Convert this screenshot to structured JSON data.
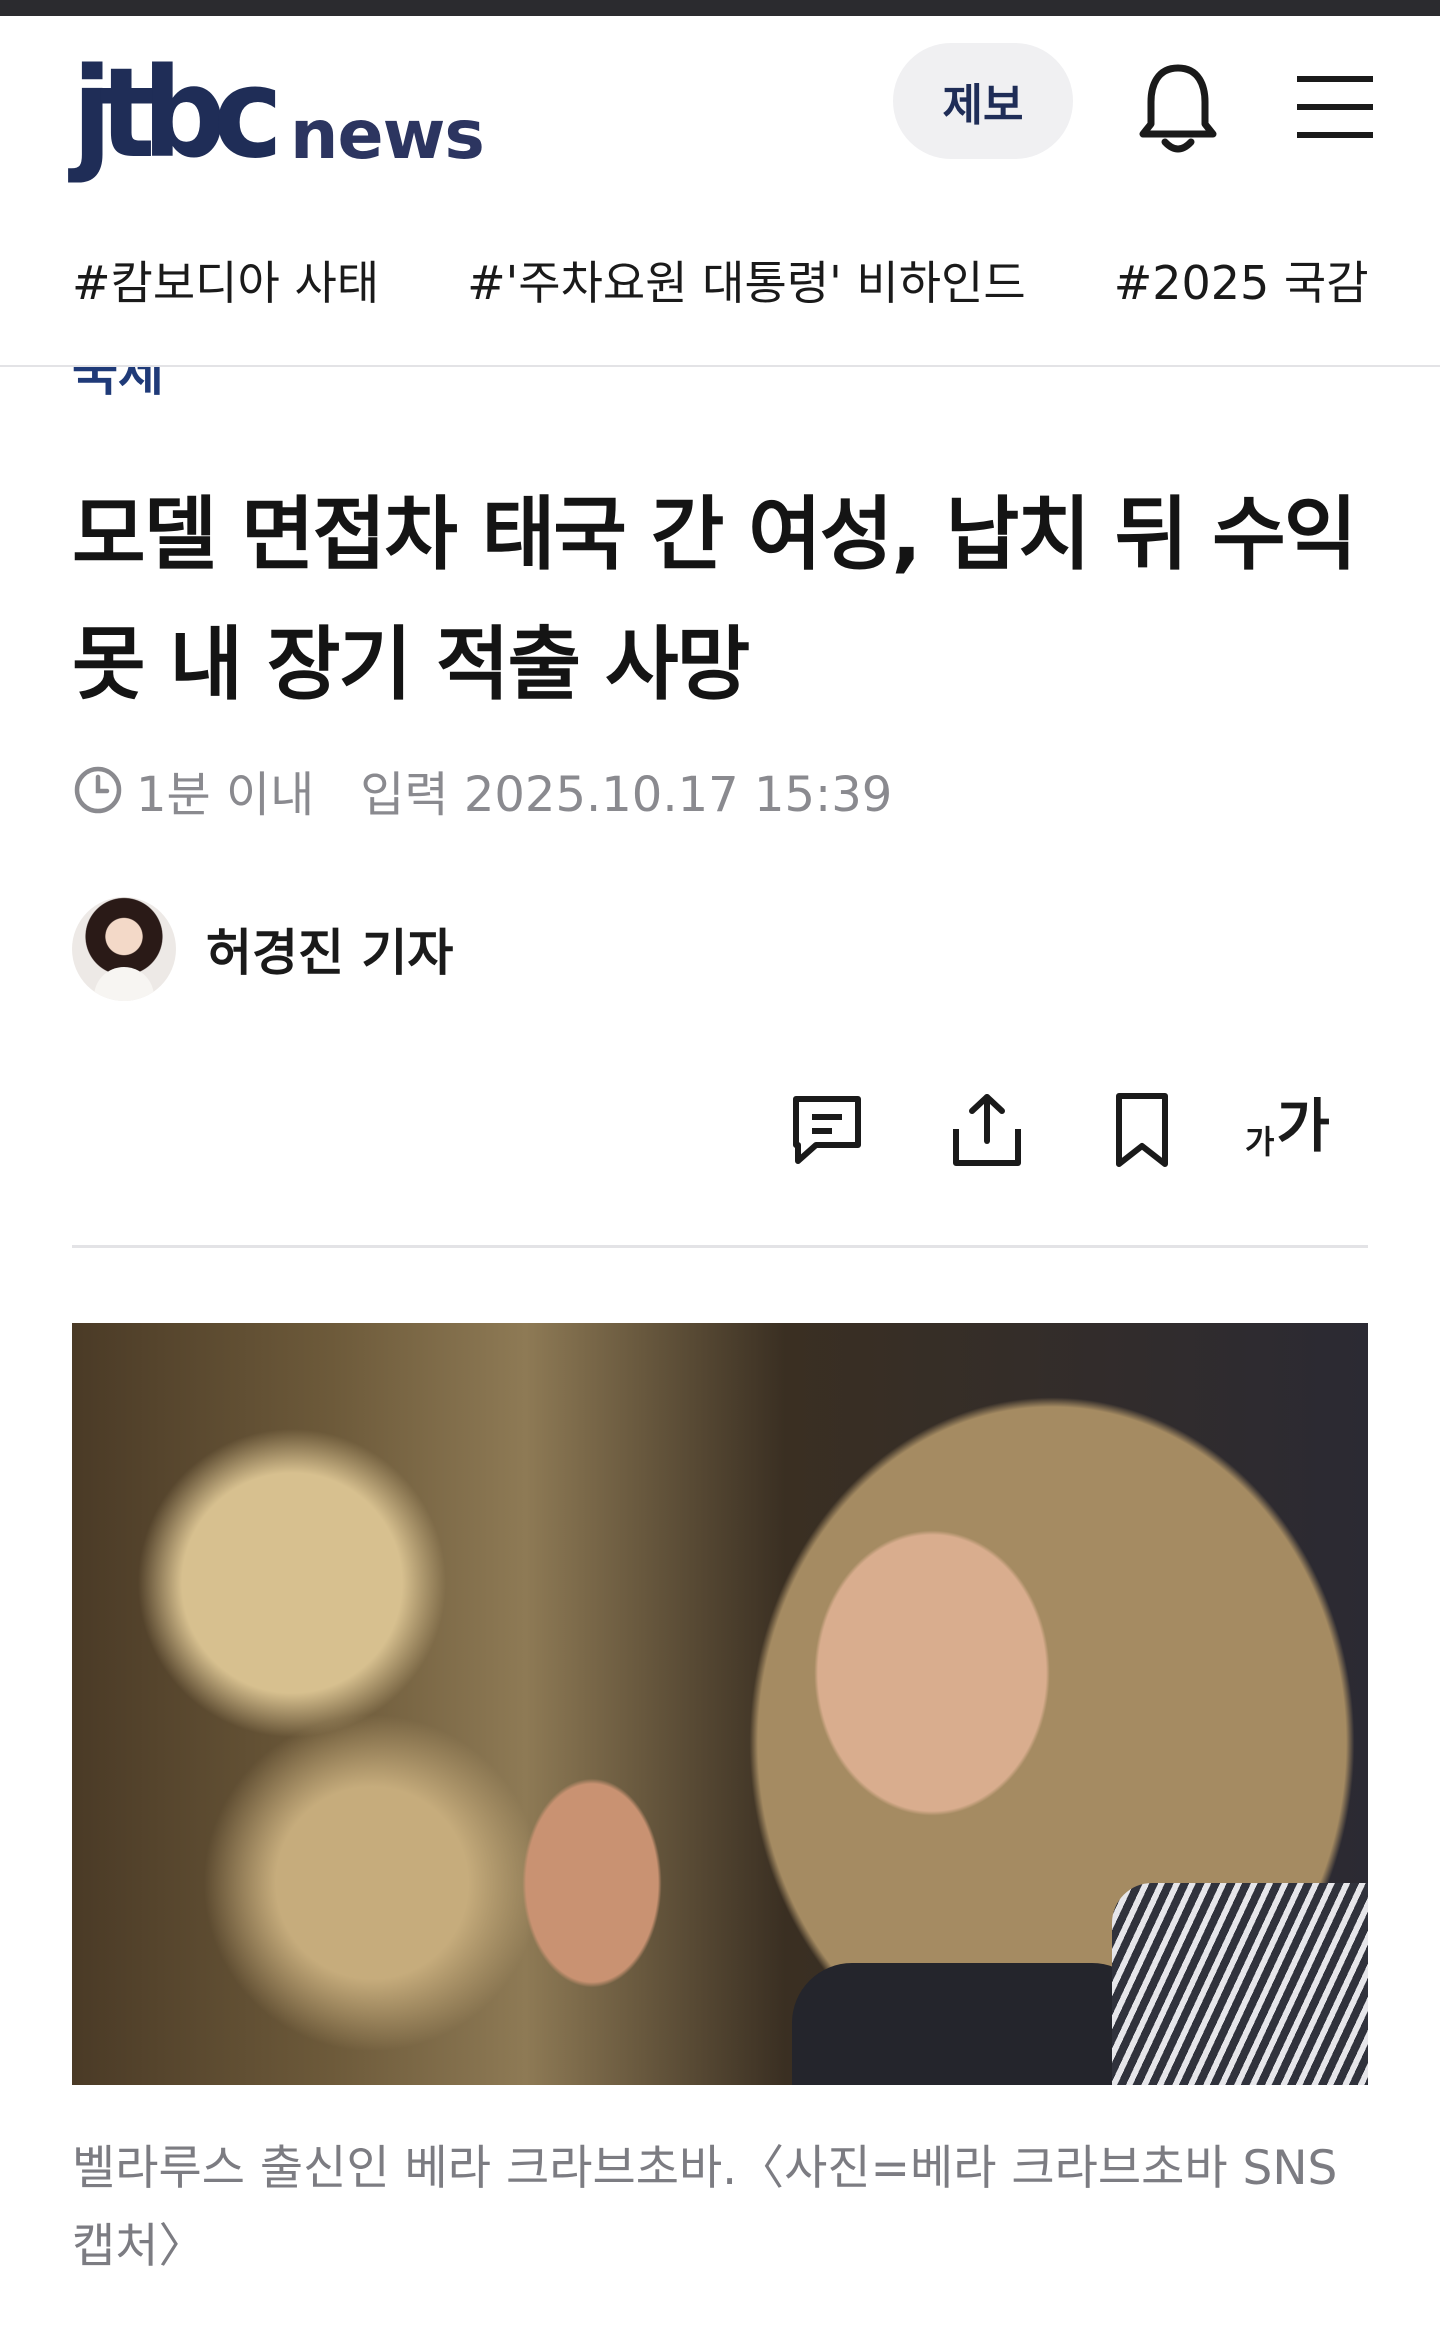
{
  "header": {
    "logo_main": "jtbc",
    "logo_sub": "news",
    "report_label": "제보",
    "bell_icon": "bell-icon",
    "menu_icon": "hamburger-menu-icon"
  },
  "tags": [
    "#캄보디아 사태",
    "#'주차요원 대통령' 비하인드",
    "#2025 국감"
  ],
  "article": {
    "section": "국제",
    "headline": "모델 면접차 태국 간 여성, 납치 뒤 수익 못 내 장기 적출 사망",
    "read_time": "1분 이내",
    "published": "입력 2025.10.17 15:39",
    "reporter": "허경진 기자",
    "caption": "벨라루스 출신인 베라 크라브초바.〈사진=베라 크라브초바 SNS 캡처〉"
  },
  "actions": {
    "comment_icon": "comment-icon",
    "share_icon": "share-icon",
    "bookmark_icon": "bookmark-icon",
    "font_small": "가",
    "font_big": "가"
  },
  "colors": {
    "brand_navy": "#1f2d57",
    "section_blue": "#1f3a78",
    "meta_gray": "#8a8a8f"
  }
}
